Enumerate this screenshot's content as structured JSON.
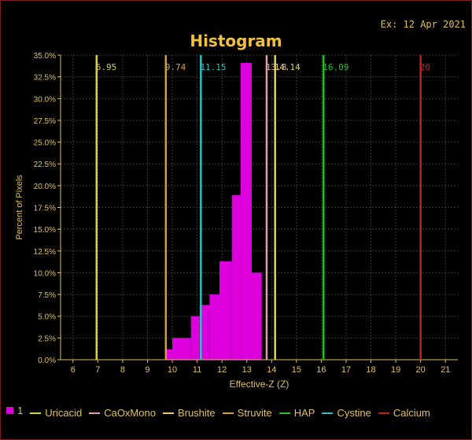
{
  "header": {
    "date": "Ex: 12 Apr 2021"
  },
  "chart_data": {
    "type": "bar",
    "title": "Histogram",
    "xlabel": "Effective-Z (Z)",
    "ylabel": "Percent of Pixels",
    "xlim": [
      5.5,
      21.5
    ],
    "ylim": [
      0,
      35
    ],
    "x_ticks": [
      "6",
      "7",
      "8",
      "9",
      "10",
      "11",
      "12",
      "13",
      "14",
      "15",
      "16",
      "17",
      "18",
      "19",
      "20",
      "21"
    ],
    "y_ticks": [
      "0.0%",
      "2.5%",
      "5.0%",
      "7.5%",
      "10.0%",
      "12.5%",
      "15.0%",
      "17.5%",
      "20.0%",
      "22.5%",
      "25.0%",
      "27.5%",
      "30.0%",
      "32.5%",
      "35.0%"
    ],
    "grid": true,
    "series": [
      {
        "name": "1",
        "color": "#dd00dd",
        "bins": [
          {
            "x0": 9.75,
            "x1": 10.0,
            "y": 1.2
          },
          {
            "x0": 10.0,
            "x1": 10.75,
            "y": 2.5
          },
          {
            "x0": 10.75,
            "x1": 11.1,
            "y": 5.0
          },
          {
            "x0": 11.1,
            "x1": 11.5,
            "y": 6.3
          },
          {
            "x0": 11.5,
            "x1": 11.9,
            "y": 7.5
          },
          {
            "x0": 11.9,
            "x1": 12.4,
            "y": 11.3
          },
          {
            "x0": 12.4,
            "x1": 12.75,
            "y": 18.9
          },
          {
            "x0": 12.75,
            "x1": 13.2,
            "y": 34.1
          },
          {
            "x0": 13.2,
            "x1": 13.6,
            "y": 10.0
          }
        ]
      }
    ],
    "markers": [
      {
        "name": "Uricacid",
        "x": 6.95,
        "label": "6.95",
        "color": "#d8d040"
      },
      {
        "name": "CaOxMono",
        "x": 13.8,
        "label": "13.8",
        "color": "#e0a0a0"
      },
      {
        "name": "Brushite",
        "x": 14.14,
        "label": "14.14",
        "color": "#e0d060"
      },
      {
        "name": "Struvite",
        "x": 9.74,
        "label": "9.74",
        "color": "#d0a040"
      },
      {
        "name": "HAP",
        "x": 16.09,
        "label": "16.09",
        "color": "#20c020"
      },
      {
        "name": "Cystine",
        "x": 11.15,
        "label": "11.15",
        "color": "#30c0c0"
      },
      {
        "name": "Calcium",
        "x": 20,
        "label": "20",
        "color": "#c02020"
      }
    ],
    "legend_position": "bottom"
  }
}
